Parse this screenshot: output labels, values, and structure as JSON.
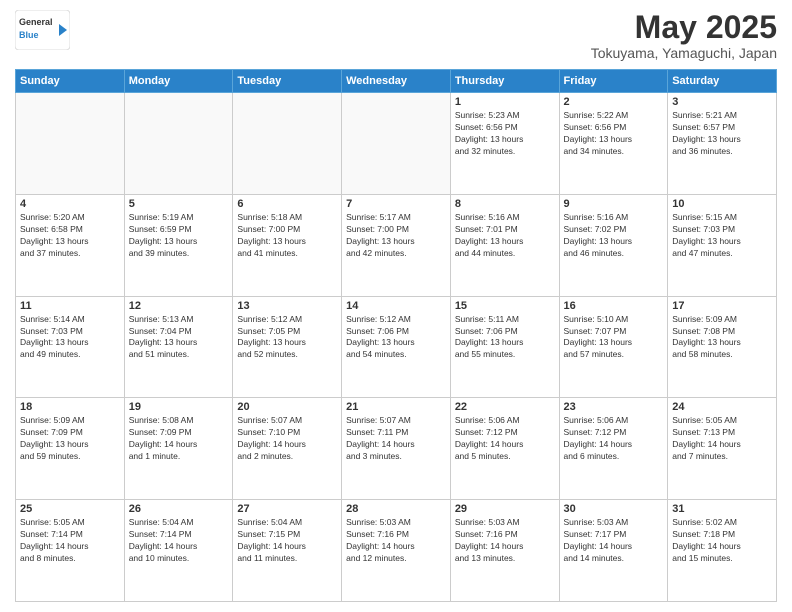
{
  "header": {
    "logo_line1": "General",
    "logo_line2": "Blue",
    "title": "May 2025",
    "subtitle": "Tokuyama, Yamaguchi, Japan"
  },
  "calendar": {
    "days_of_week": [
      "Sunday",
      "Monday",
      "Tuesday",
      "Wednesday",
      "Thursday",
      "Friday",
      "Saturday"
    ],
    "weeks": [
      [
        {
          "day": "",
          "info": ""
        },
        {
          "day": "",
          "info": ""
        },
        {
          "day": "",
          "info": ""
        },
        {
          "day": "",
          "info": ""
        },
        {
          "day": "1",
          "info": "Sunrise: 5:23 AM\nSunset: 6:56 PM\nDaylight: 13 hours\nand 32 minutes."
        },
        {
          "day": "2",
          "info": "Sunrise: 5:22 AM\nSunset: 6:56 PM\nDaylight: 13 hours\nand 34 minutes."
        },
        {
          "day": "3",
          "info": "Sunrise: 5:21 AM\nSunset: 6:57 PM\nDaylight: 13 hours\nand 36 minutes."
        }
      ],
      [
        {
          "day": "4",
          "info": "Sunrise: 5:20 AM\nSunset: 6:58 PM\nDaylight: 13 hours\nand 37 minutes."
        },
        {
          "day": "5",
          "info": "Sunrise: 5:19 AM\nSunset: 6:59 PM\nDaylight: 13 hours\nand 39 minutes."
        },
        {
          "day": "6",
          "info": "Sunrise: 5:18 AM\nSunset: 7:00 PM\nDaylight: 13 hours\nand 41 minutes."
        },
        {
          "day": "7",
          "info": "Sunrise: 5:17 AM\nSunset: 7:00 PM\nDaylight: 13 hours\nand 42 minutes."
        },
        {
          "day": "8",
          "info": "Sunrise: 5:16 AM\nSunset: 7:01 PM\nDaylight: 13 hours\nand 44 minutes."
        },
        {
          "day": "9",
          "info": "Sunrise: 5:16 AM\nSunset: 7:02 PM\nDaylight: 13 hours\nand 46 minutes."
        },
        {
          "day": "10",
          "info": "Sunrise: 5:15 AM\nSunset: 7:03 PM\nDaylight: 13 hours\nand 47 minutes."
        }
      ],
      [
        {
          "day": "11",
          "info": "Sunrise: 5:14 AM\nSunset: 7:03 PM\nDaylight: 13 hours\nand 49 minutes."
        },
        {
          "day": "12",
          "info": "Sunrise: 5:13 AM\nSunset: 7:04 PM\nDaylight: 13 hours\nand 51 minutes."
        },
        {
          "day": "13",
          "info": "Sunrise: 5:12 AM\nSunset: 7:05 PM\nDaylight: 13 hours\nand 52 minutes."
        },
        {
          "day": "14",
          "info": "Sunrise: 5:12 AM\nSunset: 7:06 PM\nDaylight: 13 hours\nand 54 minutes."
        },
        {
          "day": "15",
          "info": "Sunrise: 5:11 AM\nSunset: 7:06 PM\nDaylight: 13 hours\nand 55 minutes."
        },
        {
          "day": "16",
          "info": "Sunrise: 5:10 AM\nSunset: 7:07 PM\nDaylight: 13 hours\nand 57 minutes."
        },
        {
          "day": "17",
          "info": "Sunrise: 5:09 AM\nSunset: 7:08 PM\nDaylight: 13 hours\nand 58 minutes."
        }
      ],
      [
        {
          "day": "18",
          "info": "Sunrise: 5:09 AM\nSunset: 7:09 PM\nDaylight: 13 hours\nand 59 minutes."
        },
        {
          "day": "19",
          "info": "Sunrise: 5:08 AM\nSunset: 7:09 PM\nDaylight: 14 hours\nand 1 minute."
        },
        {
          "day": "20",
          "info": "Sunrise: 5:07 AM\nSunset: 7:10 PM\nDaylight: 14 hours\nand 2 minutes."
        },
        {
          "day": "21",
          "info": "Sunrise: 5:07 AM\nSunset: 7:11 PM\nDaylight: 14 hours\nand 3 minutes."
        },
        {
          "day": "22",
          "info": "Sunrise: 5:06 AM\nSunset: 7:12 PM\nDaylight: 14 hours\nand 5 minutes."
        },
        {
          "day": "23",
          "info": "Sunrise: 5:06 AM\nSunset: 7:12 PM\nDaylight: 14 hours\nand 6 minutes."
        },
        {
          "day": "24",
          "info": "Sunrise: 5:05 AM\nSunset: 7:13 PM\nDaylight: 14 hours\nand 7 minutes."
        }
      ],
      [
        {
          "day": "25",
          "info": "Sunrise: 5:05 AM\nSunset: 7:14 PM\nDaylight: 14 hours\nand 8 minutes."
        },
        {
          "day": "26",
          "info": "Sunrise: 5:04 AM\nSunset: 7:14 PM\nDaylight: 14 hours\nand 10 minutes."
        },
        {
          "day": "27",
          "info": "Sunrise: 5:04 AM\nSunset: 7:15 PM\nDaylight: 14 hours\nand 11 minutes."
        },
        {
          "day": "28",
          "info": "Sunrise: 5:03 AM\nSunset: 7:16 PM\nDaylight: 14 hours\nand 12 minutes."
        },
        {
          "day": "29",
          "info": "Sunrise: 5:03 AM\nSunset: 7:16 PM\nDaylight: 14 hours\nand 13 minutes."
        },
        {
          "day": "30",
          "info": "Sunrise: 5:03 AM\nSunset: 7:17 PM\nDaylight: 14 hours\nand 14 minutes."
        },
        {
          "day": "31",
          "info": "Sunrise: 5:02 AM\nSunset: 7:18 PM\nDaylight: 14 hours\nand 15 minutes."
        }
      ]
    ]
  }
}
